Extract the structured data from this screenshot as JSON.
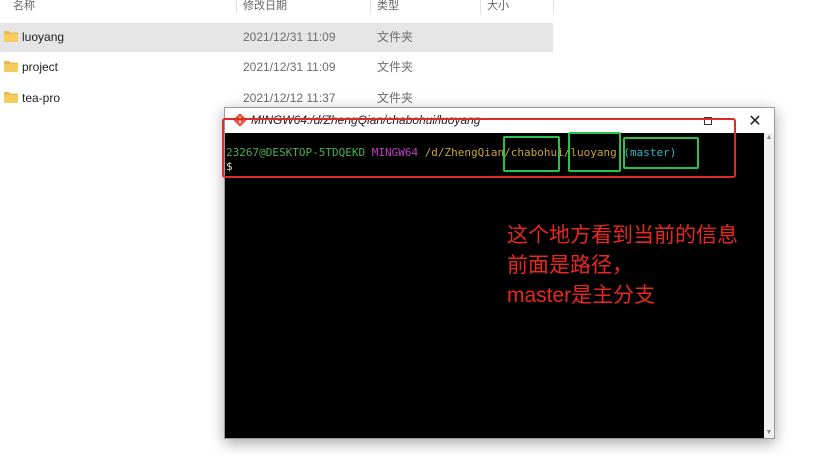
{
  "explorer": {
    "columns": {
      "name": "名称",
      "date": "修改日期",
      "type": "类型",
      "size": "大小"
    },
    "rows": [
      {
        "name": "luoyang",
        "date": "2021/12/31 11:09",
        "type": "文件夹",
        "selected": true
      },
      {
        "name": "project",
        "date": "2021/12/31 11:09",
        "type": "文件夹",
        "selected": false
      },
      {
        "name": "tea-pro",
        "date": "2021/12/12 11:37",
        "type": "文件夹",
        "selected": false
      }
    ],
    "folder_color": "#e8b84a"
  },
  "terminal": {
    "title": "MINGW64:/d/ZhengQian/chabohui/luoyang",
    "prompt": {
      "user_host": "23267@DESKTOP-5TDQEKD",
      "system": "MINGW64",
      "path_prefix": "/d/ZhengQian/",
      "path_dir1": "chabohui",
      "path_sep": "/",
      "path_dir2": "luoyang",
      "branch": "(master)"
    },
    "cursor": "$",
    "colors": {
      "user_host": "#4caf50",
      "system": "#c040c0",
      "path": "#c8a536",
      "branch": "#2fb8c8"
    }
  },
  "annotation": {
    "line1": "这个地方看到当前的信息",
    "line2": "前面是路径，",
    "line3": "master是主分支",
    "color": "#e8281f"
  },
  "icons": {
    "folder": "folder-icon",
    "app": "git-bash-icon",
    "maximize": "maximize-icon",
    "close": "close-icon",
    "scroll_up": "scroll-up-icon",
    "scroll_down": "scroll-down-icon"
  }
}
